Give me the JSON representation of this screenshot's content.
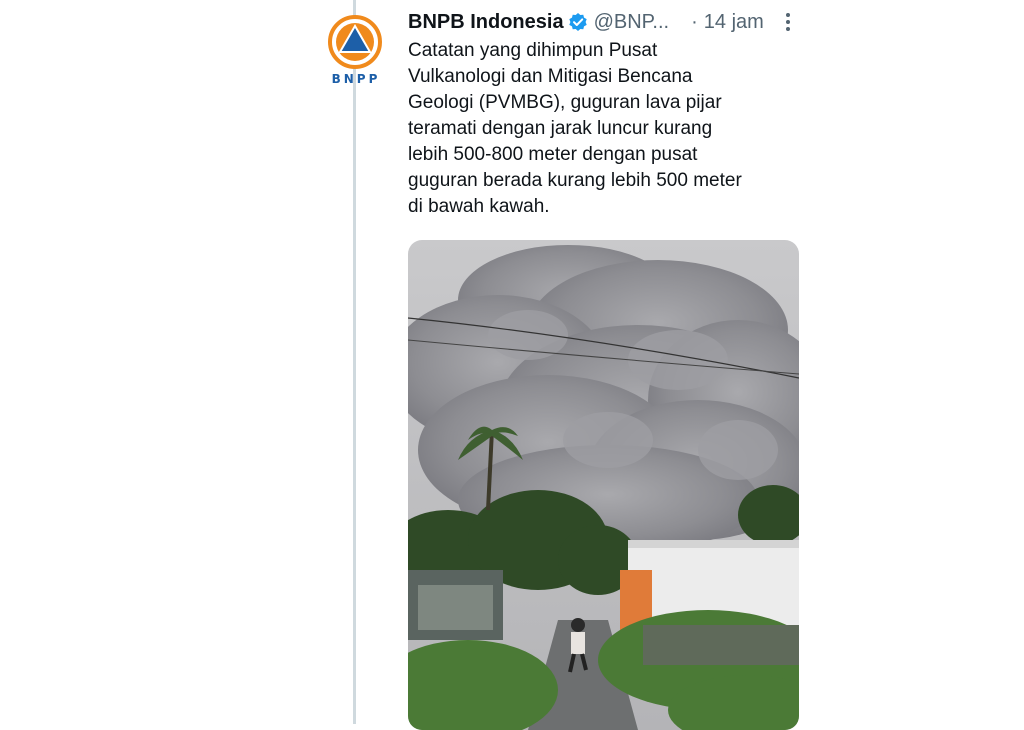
{
  "tweet": {
    "display_name": "BNPB Indonesia",
    "handle": "@BNP...",
    "separator": "·",
    "timestamp": "14 jam",
    "text": "Catatan yang dihimpun Pusat\nVulkanologi dan Mitigasi Bencana\nGeologi (PVMBG), guguran lava pijar\nteramati dengan jarak luncur kurang\nlebih 500-800 meter dengan pusat\nguguran berada kurang lebih 500 meter\ndi bawah kawah."
  },
  "avatar": {
    "logo_text": "BNPP"
  },
  "icons": {
    "verified": "verified-badge-icon",
    "more": "more-options-icon"
  },
  "colors": {
    "verified": "#1d9bf0",
    "logo_orange": "#f08a1c",
    "logo_blue": "#1d5fa8",
    "thread_line": "#cfd9de"
  }
}
